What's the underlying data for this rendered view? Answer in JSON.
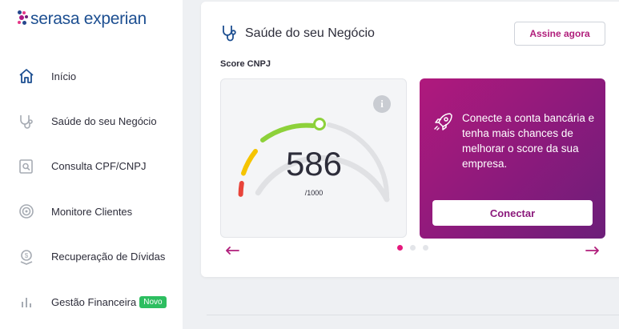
{
  "brand": {
    "logo_text": "serasa experian"
  },
  "sidebar": {
    "items": [
      {
        "label": "Início",
        "icon": "home-icon"
      },
      {
        "label": "Saúde do seu Negócio",
        "icon": "stethoscope-icon"
      },
      {
        "label": "Consulta CPF/CNPJ",
        "icon": "document-search-icon"
      },
      {
        "label": "Monitore Clientes",
        "icon": "radar-icon"
      },
      {
        "label": "Recuperação de Dívidas",
        "icon": "money-shield-icon"
      },
      {
        "label": "Gestão Financeira",
        "icon": "bar-chart-icon",
        "badge": "Novo"
      }
    ]
  },
  "card": {
    "title": "Saúde do seu Negócio",
    "subscribe_label": "Assine agora",
    "score_label": "Score CNPJ",
    "score": {
      "value": "586",
      "max": "/1000",
      "fraction": 0.586
    },
    "promo": {
      "text": "Conecte a conta bancária e tenha mais chances de melhorar o score da sua empresa.",
      "button_label": "Conectar",
      "icon": "rocket-icon"
    },
    "carousel": {
      "pages": 3,
      "active_index": 0
    }
  },
  "colors": {
    "brand_blue": "#1d4f91",
    "brand_magenta": "#b01e7b",
    "badge_green": "#2dbe60",
    "gauge_red": "#e8443a",
    "gauge_yellow": "#f5c400",
    "gauge_green": "#8dd13a",
    "dot_active": "#e5197d"
  }
}
